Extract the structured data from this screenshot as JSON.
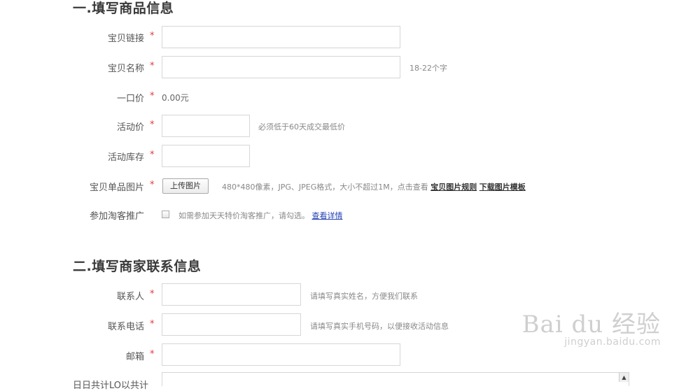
{
  "section1": {
    "title": "一.填写商品信息",
    "fields": {
      "link_label": "宝贝链接",
      "name_label": "宝贝名称",
      "name_hint": "18-22个字",
      "price_label": "一口价",
      "price_value": "0.00元",
      "activity_price_label": "活动价",
      "activity_price_hint": "必须低于60天成交最低价",
      "stock_label": "活动库存",
      "image_label": "宝贝单品图片",
      "upload_button": "上传图片",
      "image_hint": "480*480像素，JPG、JPEG格式，大小不超过1M，点击查看",
      "image_rules_link": "宝贝图片规则",
      "image_template_link": "下载图片模板",
      "promo_label": "参加淘客推广",
      "promo_hint": "如需参加天天特价淘客推广，请勾选。",
      "promo_detail_link": "查看详情"
    }
  },
  "section2": {
    "title": "二.填写商家联系信息",
    "fields": {
      "contact_label": "联系人",
      "contact_hint": "请填写真实姓名，方便我们联系",
      "phone_label": "联系电话",
      "phone_hint": "请填写真实手机号码，以便接收活动信息",
      "email_label": "邮箱",
      "cut_label": "日日共计LO以共计"
    }
  },
  "required_mark": "*",
  "scroll_up_glyph": "▲",
  "watermark": {
    "logo": "Bai du 经验",
    "sub": "jingyan.baidu.com"
  },
  "colors": {
    "required": "#e4393c",
    "link_blue": "#2440b3",
    "title": "#3a3a3a"
  }
}
